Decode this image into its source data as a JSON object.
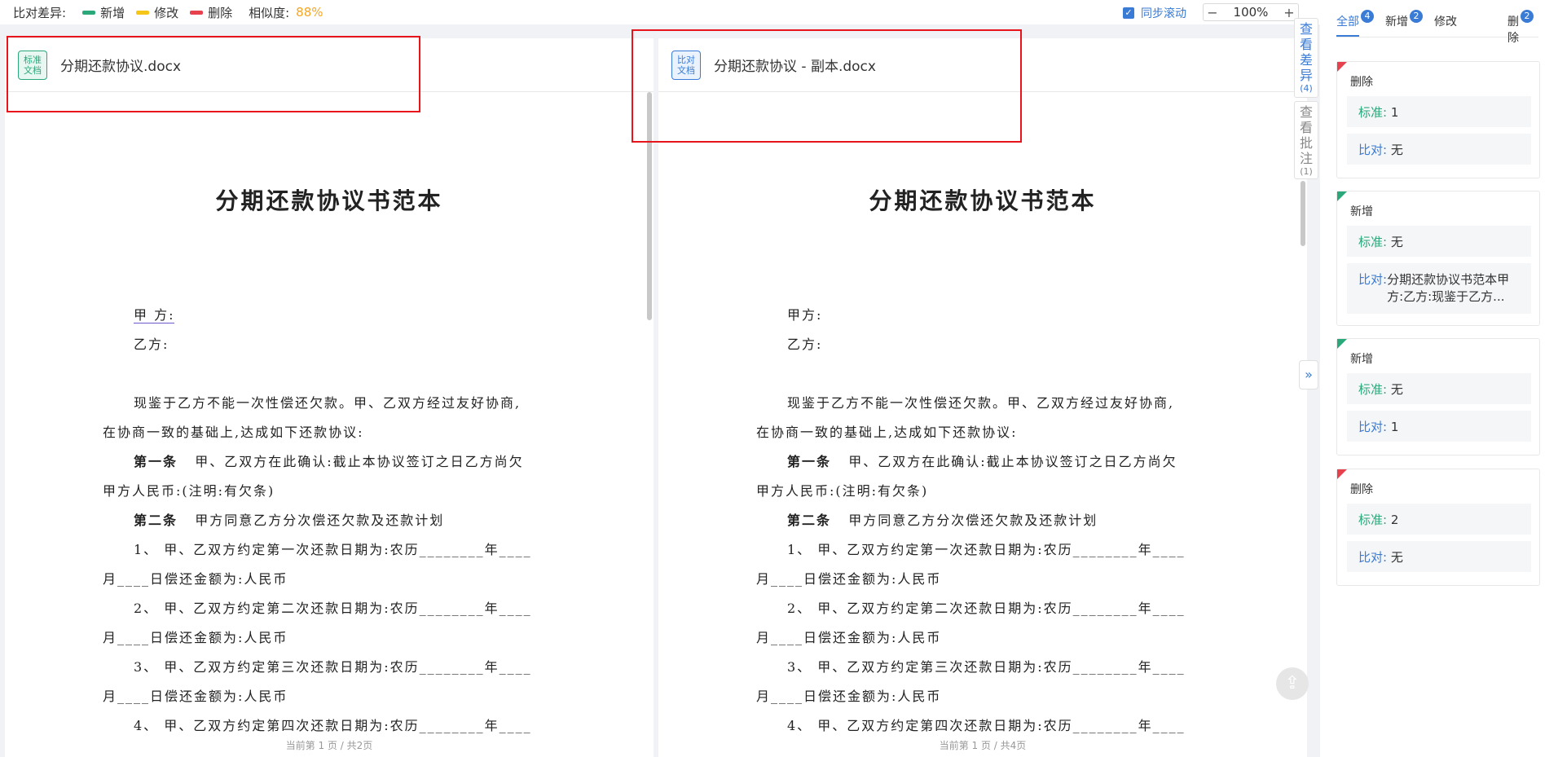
{
  "toolbar": {
    "legend_title": "比对差异:",
    "legend": [
      {
        "label": "新增",
        "color": "#2aa87a"
      },
      {
        "label": "修改",
        "color": "#f5c518"
      },
      {
        "label": "删除",
        "color": "#e8414e"
      }
    ],
    "similarity_label": "相似度:",
    "similarity_value": "88%",
    "sync_scroll": "同步滚动",
    "sync_checked": true,
    "zoom_minus": "−",
    "zoom_value": "100%",
    "zoom_plus": "+"
  },
  "left_doc": {
    "badge": [
      "标准",
      "文档"
    ],
    "file_name": "分期还款协议.docx",
    "pager": "当前第 1 页 / 共2页"
  },
  "right_doc": {
    "badge": [
      "比对",
      "文档"
    ],
    "file_name": "分期还款协议 - 副本.docx",
    "pager": "当前第 1 页 / 共4页"
  },
  "document": {
    "title": "分期还款协议书范本",
    "party_a": "甲 方:",
    "party_a_right": "甲方:",
    "party_b": "乙方:",
    "p1_line1": "现鉴于乙方不能一次性偿还欠款。甲、乙双方经过友好协商,",
    "p1_line2": "在协商一致的基础上,达成如下还款协议:",
    "art1_head": "第一条",
    "art1_line1": "甲、乙双方在此确认:截止本协议签订之日乙方尚欠",
    "art1_line2": "甲方人民币:(注明:有欠条)",
    "art2_head": "第二条",
    "art2_line1": "甲方同意乙方分次偿还欠款及还款计划",
    "item1_line1": "1、 甲、乙双方约定第一次还款日期为:农历________年____",
    "item1_line2": "月____日偿还金额为:人民币",
    "item2_line1": "2、 甲、乙双方约定第二次还款日期为:农历________年____",
    "item2_line2": "月____日偿还金额为:人民币",
    "item3_line1": "3、 甲、乙双方约定第三次还款日期为:农历________年____",
    "item3_line2": "月____日偿还金额为:人民币",
    "item4_line1": "4、 甲、乙双方约定第四次还款日期为:农历________年____"
  },
  "tool_tabs": {
    "view_diff": "查看差异",
    "view_diff_count": "(4)",
    "view_comment": "查看批注",
    "view_comment_count": "(1)",
    "expand": "»",
    "back_to_top": "⇪"
  },
  "sidebar": {
    "tabs": [
      {
        "label": "全部",
        "count": "4"
      },
      {
        "label": "新增",
        "count": "2"
      },
      {
        "label": "修改",
        "count": ""
      },
      {
        "label": "删除",
        "count": "2"
      }
    ],
    "std_label": "标准:",
    "cmp_label": "比对:",
    "cards": [
      {
        "type": "删除",
        "color": "#e8414e",
        "std": "1",
        "cmp": "无"
      },
      {
        "type": "新增",
        "color": "#2aa87a",
        "std": "无",
        "cmp": "分期还款协议书范本甲方:乙方:现鉴于乙方..."
      },
      {
        "type": "新增",
        "color": "#2aa87a",
        "std": "无",
        "cmp": "1"
      },
      {
        "type": "删除",
        "color": "#e8414e",
        "std": "2",
        "cmp": "无"
      }
    ]
  }
}
